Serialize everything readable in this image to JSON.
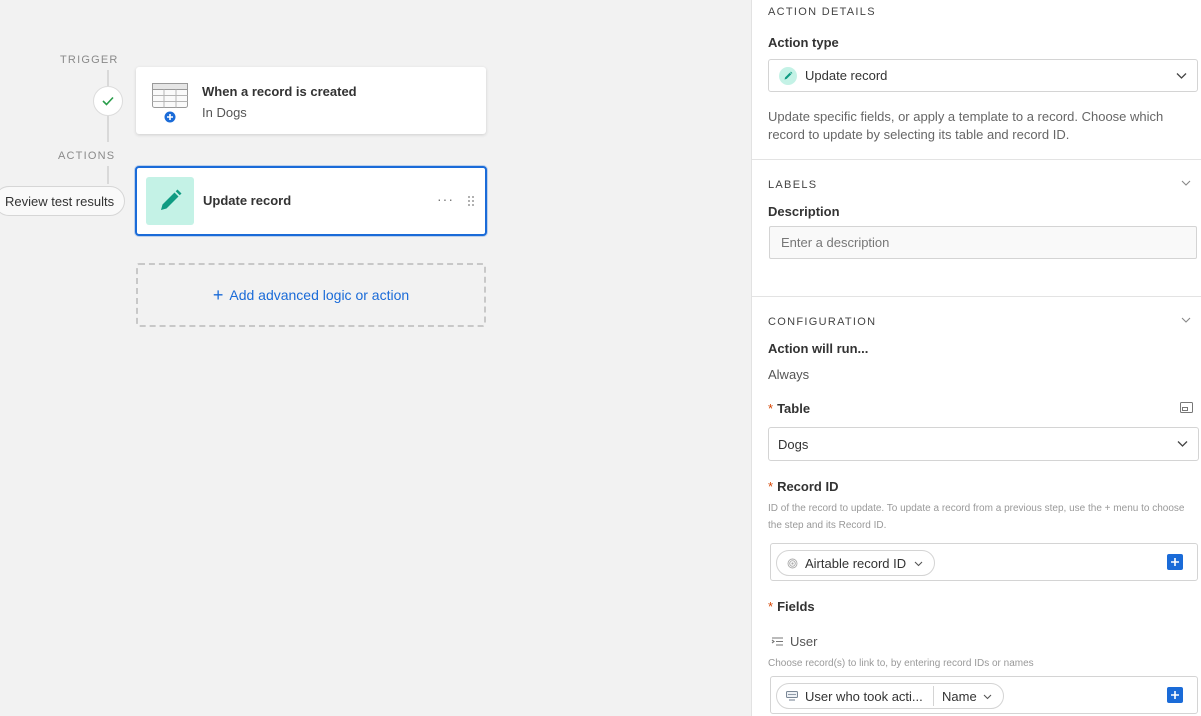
{
  "canvas": {
    "trigger_label": "TRIGGER",
    "actions_label": "ACTIONS",
    "review_button": "Review test results",
    "trigger_card": {
      "title": "When a record is created",
      "subtitle": "In Dogs"
    },
    "action_card": {
      "title": "Update record",
      "more": "···"
    },
    "add_button": {
      "plus": "+",
      "label": "Add advanced logic or action"
    }
  },
  "panel": {
    "action_details": {
      "heading": "ACTION DETAILS",
      "action_type_label": "Action type",
      "action_type_value": "Update record",
      "description": "Update specific fields, or apply a template to a record. Choose which record to update by selecting its table and record ID."
    },
    "labels": {
      "heading": "LABELS",
      "description_label": "Description",
      "description_placeholder": "Enter a description"
    },
    "configuration": {
      "heading": "CONFIGURATION",
      "run_label": "Action will run...",
      "run_value": "Always",
      "required_mark": "*",
      "table_label": "Table",
      "table_value": "Dogs",
      "record_id_label": "Record ID",
      "record_id_help": "ID of the record to update. To update a record from a previous step, use the + menu to choose the step and its Record ID.",
      "record_id_token": "Airtable record ID",
      "fields_label": "Fields",
      "field_name": "User",
      "field_help": "Choose record(s) to link to, by entering record IDs or names",
      "field_token_main": "User who took acti...",
      "field_token_sub": "Name"
    }
  },
  "colors": {
    "accent": "#1a6bd8",
    "teal_bg": "#c4f2e6",
    "teal_icon": "#0f9b82",
    "required": "#d54401"
  }
}
